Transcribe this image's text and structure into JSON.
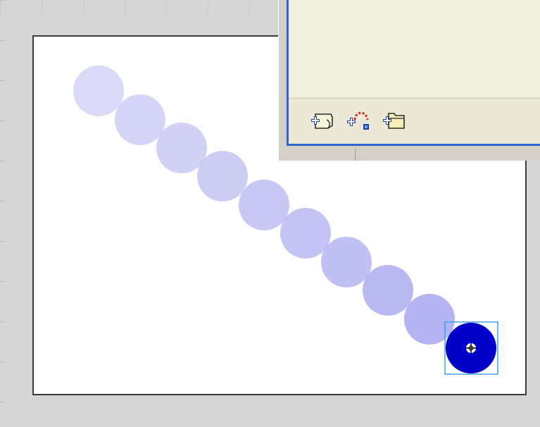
{
  "app": {
    "view": "stage-with-onion-skin",
    "stage": {
      "background": "#ffffff",
      "border": "#3a3a3a",
      "workspace_color": "#d6d6d6"
    },
    "motion_path": {
      "ghost_color": "#a6a7ee",
      "ghost_opacity_levels": [
        0.42,
        0.47,
        0.52,
        0.57,
        0.62,
        0.67,
        0.72,
        0.78,
        0.85
      ],
      "current_frame_color": "#0000c8",
      "selection_color": "#3ea0e8",
      "registration_icon": "registration-point-icon"
    },
    "panel": {
      "frame_color": "#2b67c8",
      "toolbar": [
        {
          "name": "new-symbol-button",
          "icon": "new-symbol-icon"
        },
        {
          "name": "add-motion-guide-button",
          "icon": "add-motion-guide-icon"
        },
        {
          "name": "new-folder-button",
          "icon": "new-folder-icon"
        }
      ]
    }
  }
}
